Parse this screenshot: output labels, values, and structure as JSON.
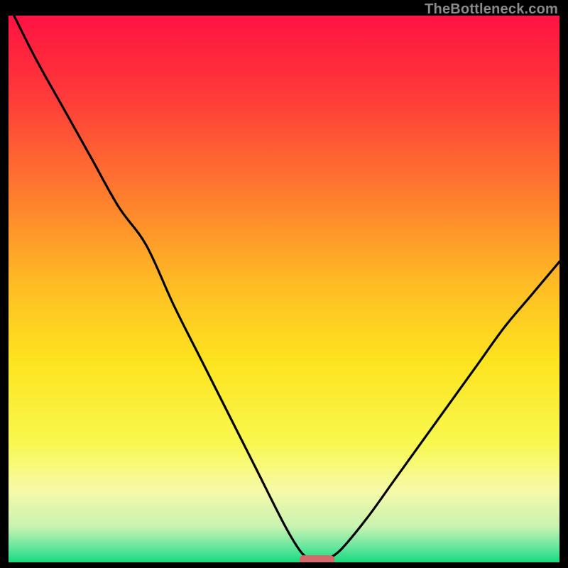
{
  "attribution": "TheBottleneck.com",
  "chart_data": {
    "type": "line",
    "title": "",
    "xlabel": "",
    "ylabel": "",
    "xlim": [
      0,
      100
    ],
    "ylim": [
      0,
      100
    ],
    "grid": false,
    "legend": false,
    "background": {
      "type": "vertical-gradient",
      "stops": [
        {
          "offset": 0.0,
          "color": "#ff1342"
        },
        {
          "offset": 0.15,
          "color": "#ff3b3a"
        },
        {
          "offset": 0.33,
          "color": "#ff7d2e"
        },
        {
          "offset": 0.5,
          "color": "#ffbf24"
        },
        {
          "offset": 0.63,
          "color": "#fde31f"
        },
        {
          "offset": 0.78,
          "color": "#f8f84e"
        },
        {
          "offset": 0.87,
          "color": "#f6faa9"
        },
        {
          "offset": 0.935,
          "color": "#c8f2b0"
        },
        {
          "offset": 0.97,
          "color": "#6be7a0"
        },
        {
          "offset": 1.0,
          "color": "#17da7e"
        }
      ]
    },
    "series": [
      {
        "name": "bottleneck-curve",
        "color": "#000000",
        "x": [
          1,
          5,
          10,
          15,
          20,
          25,
          30,
          35,
          40,
          45,
          50,
          53,
          55,
          57,
          60,
          65,
          70,
          75,
          80,
          85,
          90,
          95,
          100
        ],
        "y": [
          100,
          92,
          83,
          74,
          65,
          58,
          47,
          37,
          27,
          17,
          7,
          2,
          0.5,
          0.5,
          2,
          8,
          15,
          22,
          29,
          36,
          43,
          49,
          55
        ]
      }
    ],
    "marker": {
      "name": "optimal-range",
      "shape": "pill",
      "color": "#d46a6a",
      "x_center": 56,
      "x_halfwidth": 3.2,
      "y": 0.5
    }
  }
}
